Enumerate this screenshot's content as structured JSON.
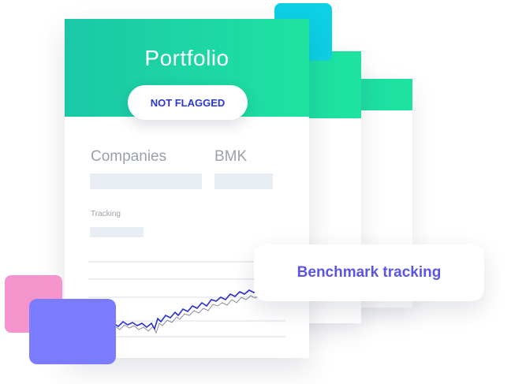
{
  "portfolio": {
    "title": "Portfolio",
    "flag_status": "NOT FLAGGED",
    "columns": {
      "companies": "Companies",
      "bmk": "BMK"
    },
    "tracking_label": "Tracking"
  },
  "bubble": {
    "label": "Benchmark tracking"
  },
  "colors": {
    "band_green": "#1fe2a0",
    "pill_text": "#2a36d9",
    "bubble_text": "#5b55e6",
    "square_cyan": "#0dd0e4",
    "square_pink": "#f694ce",
    "square_purple": "#7b7bff",
    "line_portfolio": "#2a2fd1",
    "line_benchmark": "#8a8f98"
  },
  "icons": [
    "decorative-square-cyan",
    "decorative-square-pink",
    "decorative-square-purple"
  ]
}
